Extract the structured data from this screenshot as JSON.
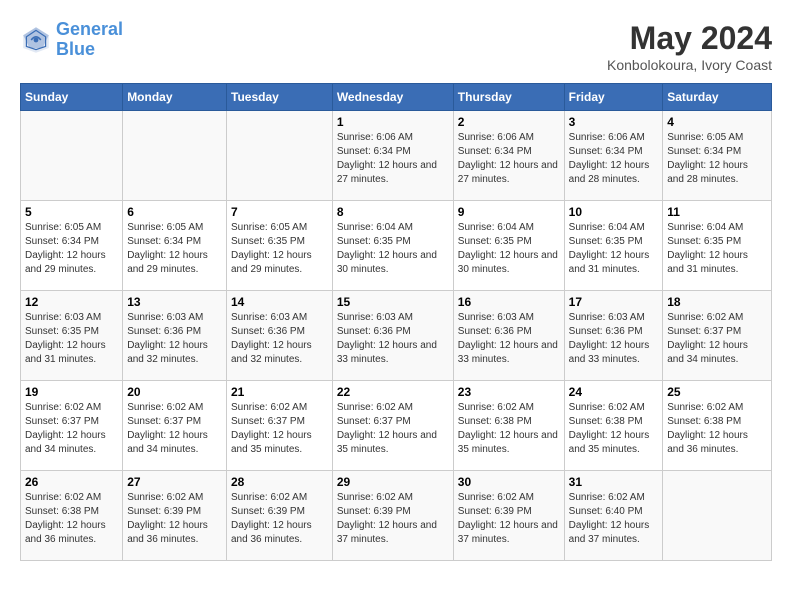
{
  "header": {
    "logo_line1": "General",
    "logo_line2": "Blue",
    "main_title": "May 2024",
    "subtitle": "Konbolokoura, Ivory Coast"
  },
  "weekdays": [
    "Sunday",
    "Monday",
    "Tuesday",
    "Wednesday",
    "Thursday",
    "Friday",
    "Saturday"
  ],
  "weeks": [
    [
      {
        "day": "",
        "info": ""
      },
      {
        "day": "",
        "info": ""
      },
      {
        "day": "",
        "info": ""
      },
      {
        "day": "1",
        "info": "Sunrise: 6:06 AM\nSunset: 6:34 PM\nDaylight: 12 hours\nand 27 minutes."
      },
      {
        "day": "2",
        "info": "Sunrise: 6:06 AM\nSunset: 6:34 PM\nDaylight: 12 hours\nand 27 minutes."
      },
      {
        "day": "3",
        "info": "Sunrise: 6:06 AM\nSunset: 6:34 PM\nDaylight: 12 hours\nand 28 minutes."
      },
      {
        "day": "4",
        "info": "Sunrise: 6:05 AM\nSunset: 6:34 PM\nDaylight: 12 hours\nand 28 minutes."
      }
    ],
    [
      {
        "day": "5",
        "info": "Sunrise: 6:05 AM\nSunset: 6:34 PM\nDaylight: 12 hours\nand 29 minutes."
      },
      {
        "day": "6",
        "info": "Sunrise: 6:05 AM\nSunset: 6:34 PM\nDaylight: 12 hours\nand 29 minutes."
      },
      {
        "day": "7",
        "info": "Sunrise: 6:05 AM\nSunset: 6:35 PM\nDaylight: 12 hours\nand 29 minutes."
      },
      {
        "day": "8",
        "info": "Sunrise: 6:04 AM\nSunset: 6:35 PM\nDaylight: 12 hours\nand 30 minutes."
      },
      {
        "day": "9",
        "info": "Sunrise: 6:04 AM\nSunset: 6:35 PM\nDaylight: 12 hours\nand 30 minutes."
      },
      {
        "day": "10",
        "info": "Sunrise: 6:04 AM\nSunset: 6:35 PM\nDaylight: 12 hours\nand 31 minutes."
      },
      {
        "day": "11",
        "info": "Sunrise: 6:04 AM\nSunset: 6:35 PM\nDaylight: 12 hours\nand 31 minutes."
      }
    ],
    [
      {
        "day": "12",
        "info": "Sunrise: 6:03 AM\nSunset: 6:35 PM\nDaylight: 12 hours\nand 31 minutes."
      },
      {
        "day": "13",
        "info": "Sunrise: 6:03 AM\nSunset: 6:36 PM\nDaylight: 12 hours\nand 32 minutes."
      },
      {
        "day": "14",
        "info": "Sunrise: 6:03 AM\nSunset: 6:36 PM\nDaylight: 12 hours\nand 32 minutes."
      },
      {
        "day": "15",
        "info": "Sunrise: 6:03 AM\nSunset: 6:36 PM\nDaylight: 12 hours\nand 33 minutes."
      },
      {
        "day": "16",
        "info": "Sunrise: 6:03 AM\nSunset: 6:36 PM\nDaylight: 12 hours\nand 33 minutes."
      },
      {
        "day": "17",
        "info": "Sunrise: 6:03 AM\nSunset: 6:36 PM\nDaylight: 12 hours\nand 33 minutes."
      },
      {
        "day": "18",
        "info": "Sunrise: 6:02 AM\nSunset: 6:37 PM\nDaylight: 12 hours\nand 34 minutes."
      }
    ],
    [
      {
        "day": "19",
        "info": "Sunrise: 6:02 AM\nSunset: 6:37 PM\nDaylight: 12 hours\nand 34 minutes."
      },
      {
        "day": "20",
        "info": "Sunrise: 6:02 AM\nSunset: 6:37 PM\nDaylight: 12 hours\nand 34 minutes."
      },
      {
        "day": "21",
        "info": "Sunrise: 6:02 AM\nSunset: 6:37 PM\nDaylight: 12 hours\nand 35 minutes."
      },
      {
        "day": "22",
        "info": "Sunrise: 6:02 AM\nSunset: 6:37 PM\nDaylight: 12 hours\nand 35 minutes."
      },
      {
        "day": "23",
        "info": "Sunrise: 6:02 AM\nSunset: 6:38 PM\nDaylight: 12 hours\nand 35 minutes."
      },
      {
        "day": "24",
        "info": "Sunrise: 6:02 AM\nSunset: 6:38 PM\nDaylight: 12 hours\nand 35 minutes."
      },
      {
        "day": "25",
        "info": "Sunrise: 6:02 AM\nSunset: 6:38 PM\nDaylight: 12 hours\nand 36 minutes."
      }
    ],
    [
      {
        "day": "26",
        "info": "Sunrise: 6:02 AM\nSunset: 6:38 PM\nDaylight: 12 hours\nand 36 minutes."
      },
      {
        "day": "27",
        "info": "Sunrise: 6:02 AM\nSunset: 6:39 PM\nDaylight: 12 hours\nand 36 minutes."
      },
      {
        "day": "28",
        "info": "Sunrise: 6:02 AM\nSunset: 6:39 PM\nDaylight: 12 hours\nand 36 minutes."
      },
      {
        "day": "29",
        "info": "Sunrise: 6:02 AM\nSunset: 6:39 PM\nDaylight: 12 hours\nand 37 minutes."
      },
      {
        "day": "30",
        "info": "Sunrise: 6:02 AM\nSunset: 6:39 PM\nDaylight: 12 hours\nand 37 minutes."
      },
      {
        "day": "31",
        "info": "Sunrise: 6:02 AM\nSunset: 6:40 PM\nDaylight: 12 hours\nand 37 minutes."
      },
      {
        "day": "",
        "info": ""
      }
    ]
  ]
}
